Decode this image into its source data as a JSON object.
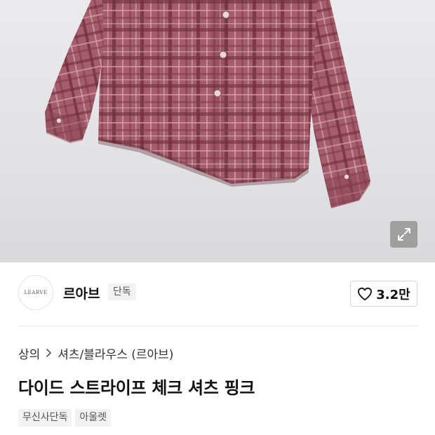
{
  "colors": {
    "shirt_base": "#a55c6c",
    "shirt_stripe_dark": "#6e2f3c",
    "shirt_stripe_light": "#d7a7b2",
    "accent_text": "#111111",
    "badge_bg": "#f2f2f2"
  },
  "hero": {
    "expand_icon": "expand-arrows-icon"
  },
  "brand": {
    "logo_text": "LEARVE",
    "name": "르아브",
    "badge": "단독"
  },
  "like": {
    "icon": "heart-outline-icon",
    "count": "3.2만"
  },
  "breadcrumb": {
    "level1": "상의",
    "separator_icon": "chevron-right-icon",
    "level2": "셔츠/블라우스 (르아브)"
  },
  "product": {
    "title": "다이드 스트라이프 체크 셔츠 핑크",
    "tags": [
      "무신사단독",
      "아울렛"
    ]
  }
}
